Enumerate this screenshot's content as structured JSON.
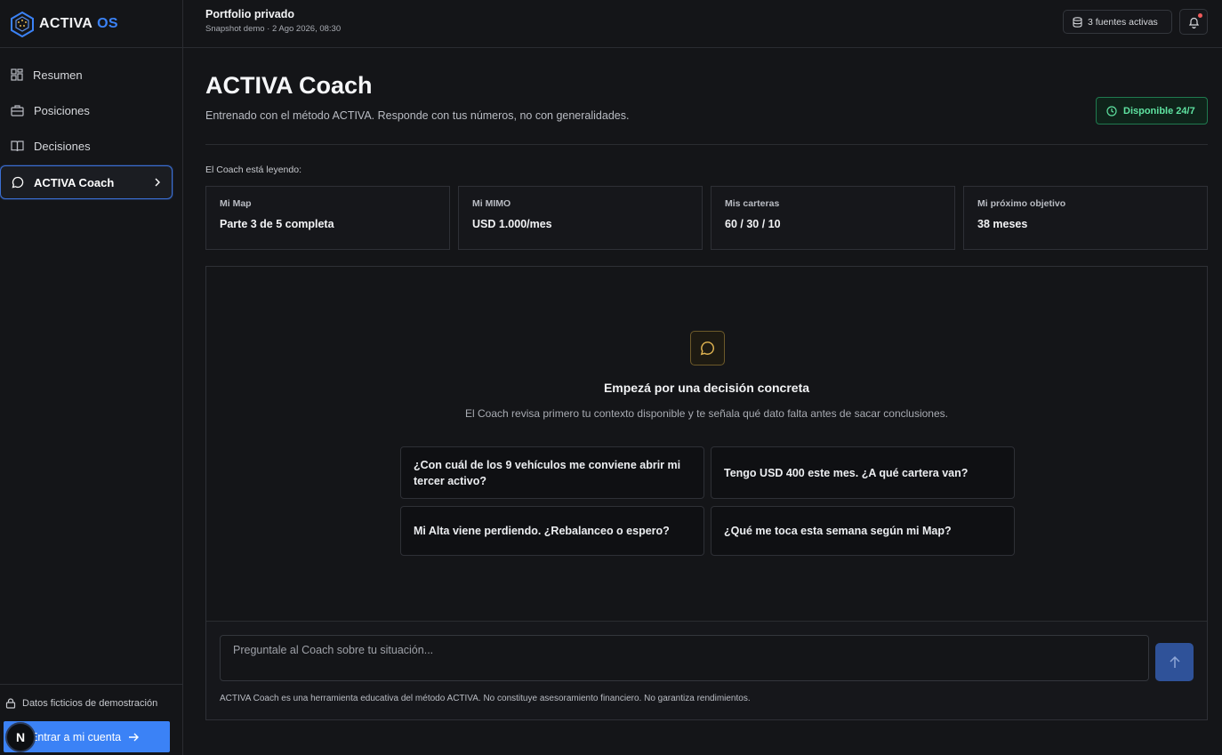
{
  "brand": {
    "name": "ACTIVA",
    "suffix": "OS",
    "accent": "#3b82f6"
  },
  "sidebar": {
    "items": [
      {
        "label": "Resumen",
        "icon": "dashboard-icon"
      },
      {
        "label": "Posiciones",
        "icon": "briefcase-icon"
      },
      {
        "label": "Decisiones",
        "icon": "book-icon"
      },
      {
        "label": "ACTIVA Coach",
        "icon": "chat-bubble-icon",
        "active": true
      }
    ],
    "demo_note": "Datos ficticios de demostración",
    "login_label": "Entrar a mi cuenta",
    "avatar_letter": "N"
  },
  "header": {
    "title": "Portfolio privado",
    "subtitle": "Snapshot demo · 2 Ago 2026, 08:30",
    "sources_label": "3 fuentes activas"
  },
  "page": {
    "title": "ACTIVA Coach",
    "description": "Entrenado con el método ACTIVA. Responde con tus números, no con generalidades.",
    "availability": "Disponible 24/7",
    "reading_label": "El Coach está leyendo:"
  },
  "context_cards": [
    {
      "label": "Mi Map",
      "value": "Parte 3 de 5 completa"
    },
    {
      "label": "Mi MIMO",
      "value": "USD 1.000/mes"
    },
    {
      "label": "Mis carteras",
      "value": "60 / 30 / 10"
    },
    {
      "label": "Mi próximo objetivo",
      "value": "38 meses"
    }
  ],
  "chat": {
    "heading": "Empezá por una decisión concreta",
    "subheading": "El Coach revisa primero tu contexto disponible y te señala qué dato falta antes de sacar conclusiones.",
    "suggestions": [
      "¿Con cuál de los 9 vehículos me conviene abrir mi tercer activo?",
      "Tengo USD 400 este mes. ¿A qué cartera van?",
      "Mi Alta viene perdiendo. ¿Rebalanceo o espero?",
      "¿Qué me toca esta semana según mi Map?"
    ],
    "input_placeholder": "Preguntale al Coach sobre tu situación...",
    "disclaimer": "ACTIVA Coach es una herramienta educativa del método ACTIVA. No constituye asesoramiento financiero. No garantiza rendimientos."
  },
  "colors": {
    "success": "#5fe3a1",
    "notification": "#f05a5a",
    "coach_accent": "#e0b451"
  }
}
